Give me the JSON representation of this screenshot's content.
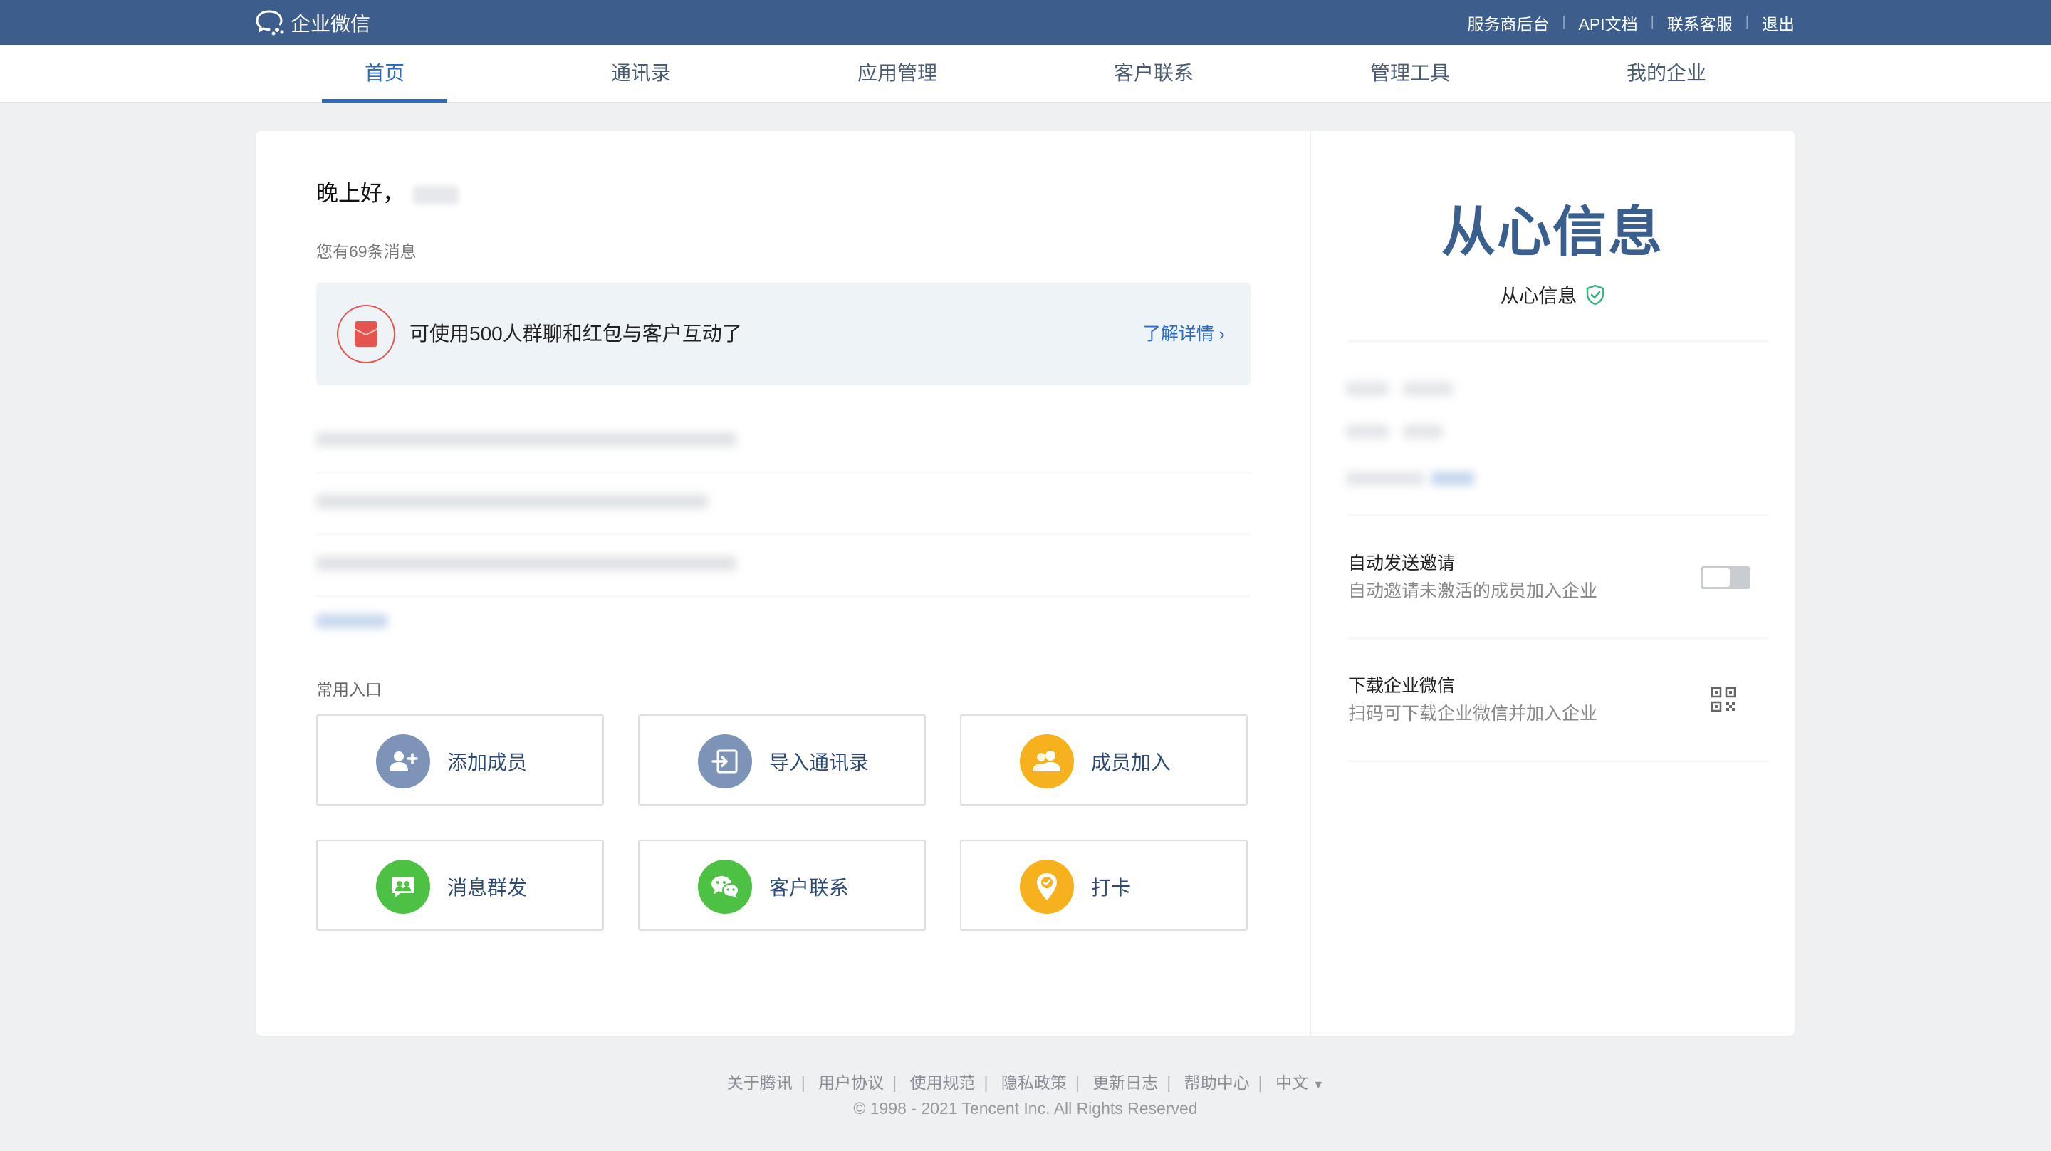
{
  "topbar": {
    "logo_text": "企业微信",
    "links": [
      "服务商后台",
      "API文档",
      "联系客服",
      "退出"
    ]
  },
  "nav": {
    "tabs": [
      "首页",
      "通讯录",
      "应用管理",
      "客户联系",
      "管理工具",
      "我的企业"
    ],
    "active": "首页"
  },
  "home": {
    "greeting": "晚上好，",
    "message_count": "您有69条消息",
    "promo": {
      "text": "可使用500人群聊和红包与客户互动了",
      "link": "了解详情 ›"
    },
    "shortcuts_title": "常用入口",
    "shortcuts": [
      {
        "label": "添加成员",
        "icon": "add-member-icon",
        "color": "#7e93b8"
      },
      {
        "label": "导入通讯录",
        "icon": "import-contacts-icon",
        "color": "#7e93b8"
      },
      {
        "label": "成员加入",
        "icon": "members-join-icon",
        "color": "#f6b11c"
      },
      {
        "label": "消息群发",
        "icon": "mass-message-icon",
        "color": "#4cc144"
      },
      {
        "label": "客户联系",
        "icon": "wechat-icon",
        "color": "#4cc144"
      },
      {
        "label": "打卡",
        "icon": "checkin-icon",
        "color": "#f6b11c"
      }
    ]
  },
  "company": {
    "logo_text": "从心信息",
    "name": "从心信息",
    "verified_icon": "verified-shield-icon"
  },
  "settings": {
    "auto_invite": {
      "title": "自动发送邀请",
      "desc": "自动邀请未激活的成员加入企业",
      "enabled": false
    },
    "download": {
      "title": "下载企业微信",
      "desc": "扫码可下载企业微信并加入企业",
      "icon": "qrcode-icon"
    }
  },
  "footer": {
    "links": [
      "关于腾讯",
      "用户协议",
      "使用规范",
      "隐私政策",
      "更新日志",
      "帮助中心"
    ],
    "language": "中文",
    "copyright": "© 1998 - 2021 Tencent Inc. All Rights Reserved"
  },
  "colors": {
    "topbar": "#3d5e8c",
    "accent": "#2d6bbf",
    "background": "#eff0f2"
  }
}
